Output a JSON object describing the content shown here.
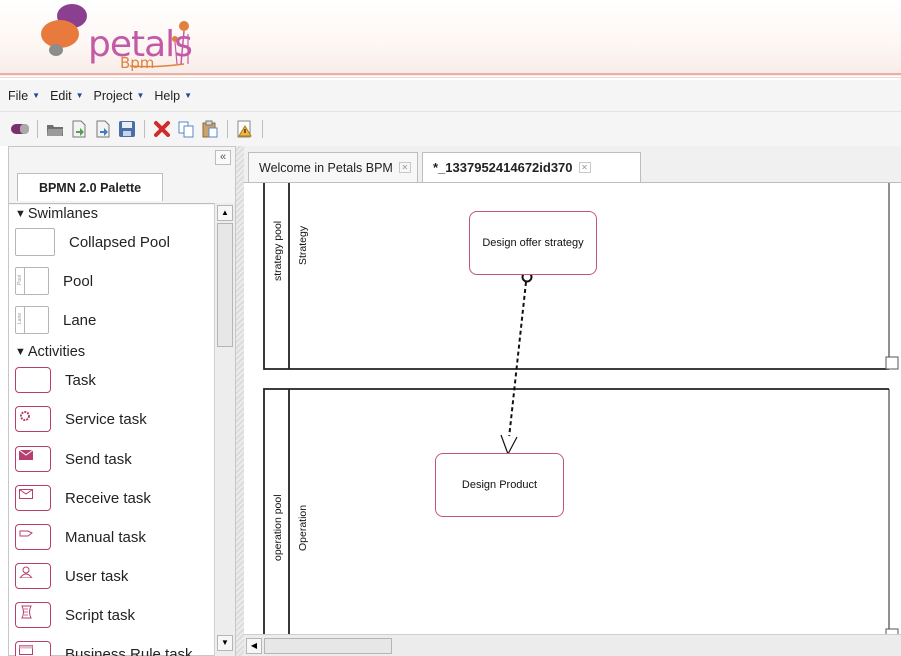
{
  "app": {
    "logo_text": "petals",
    "logo_sub": "Bpm"
  },
  "menu": {
    "items": [
      {
        "label": "File"
      },
      {
        "label": "Edit"
      },
      {
        "label": "Project"
      },
      {
        "label": "Help"
      }
    ]
  },
  "toolbar": {
    "icons": [
      "new-process-icon",
      "open-folder-icon",
      "import-icon",
      "export-icon",
      "save-icon",
      "delete-icon",
      "copy-icon",
      "paste-icon",
      "validate-warning-icon"
    ]
  },
  "palette": {
    "tab_label": "BPMN 2.0 Palette",
    "collapse_label": "«",
    "categories": {
      "swimlanes": "Swimlanes",
      "activities": "Activities"
    },
    "items": {
      "collapsed_pool": "Collapsed Pool",
      "pool": "Pool",
      "lane": "Lane",
      "task": "Task",
      "service_task": "Service task",
      "send_task": "Send task",
      "receive_task": "Receive task",
      "manual_task": "Manual task",
      "user_task": "User task",
      "script_task": "Script task",
      "business_rule_task": "Business Rule task"
    },
    "pool_icon_text": "Pool",
    "lane_icon_text": "Lane"
  },
  "editor": {
    "tabs": [
      {
        "label": "Welcome in Petals BPM",
        "active": false
      },
      {
        "label": "*_1337952414672id370",
        "active": true
      }
    ],
    "diagram": {
      "pools": [
        {
          "name": "strategy pool",
          "lane": "Strategy"
        },
        {
          "name": "operation pool",
          "lane": "Operation"
        }
      ],
      "tasks": {
        "design_offer": "Design offer strategy",
        "design_product": "Design Product"
      }
    }
  },
  "colors": {
    "accent": "#c0557f",
    "logo_purple": "#c35aa5",
    "logo_orange": "#e0823d",
    "menu_arrow": "#244a9c"
  }
}
